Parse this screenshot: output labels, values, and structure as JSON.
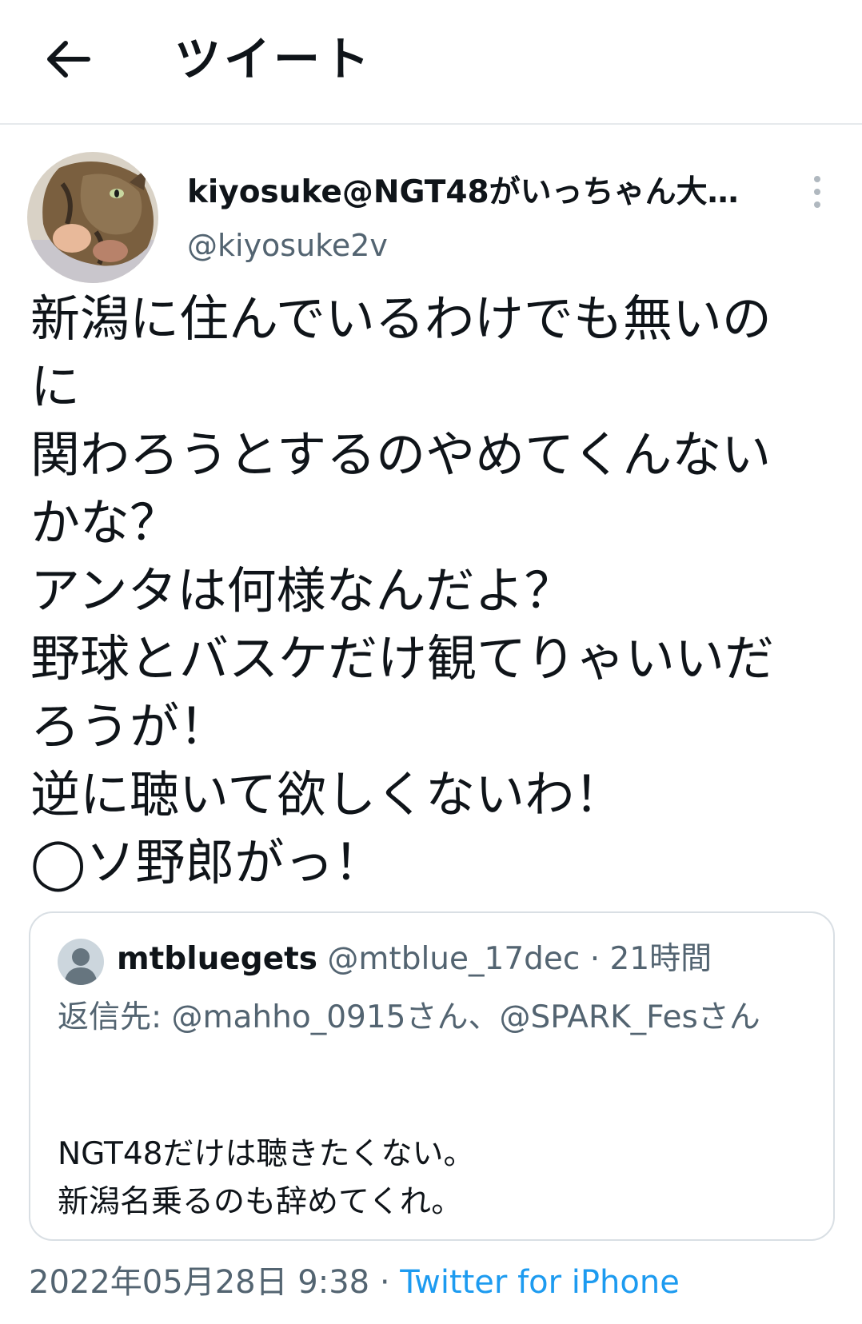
{
  "header": {
    "title": "ツイート",
    "back_icon": "arrow-left-icon"
  },
  "author": {
    "display_name": "kiyosuke@NGT48がいっちゃん大…",
    "handle": "@kiyosuke2v",
    "avatar_icon": "cat-photo-avatar",
    "more_icon": "more-vertical-icon"
  },
  "tweet": {
    "text": "新潟に住んでいるわけでも無いの\nに\n関わろうとするのやめてくんない\nかな？\nアンタは何様なんだよ？\n野球とバスケだけ観てりゃいいだ\nろうが！\n逆に聴いて欲しくないわ！\n◯ソ野郎がっ！"
  },
  "quoted_tweet": {
    "author_name": "mtbluegets",
    "author_handle": "@mtblue_17dec",
    "separator": "·",
    "time_ago": "21時間",
    "reply_prefix": "返信先:",
    "reply_to_1": "@mahho_0915",
    "reply_mid": "さん、",
    "reply_to_2": "@SPARK_Fes",
    "reply_suffix": "さん",
    "text": "NGT48だけは聴きたくない。\n新潟名乗るのも辞めてくれ。",
    "avatar_icon": "default-person-avatar"
  },
  "footer": {
    "timestamp": "2022年05月28日 9:38",
    "separator": "·",
    "source": "Twitter for iPhone"
  },
  "colors": {
    "text_primary": "#0f1419",
    "text_secondary": "#536471",
    "link": "#1d9bf0",
    "border": "#d9dfe4"
  }
}
